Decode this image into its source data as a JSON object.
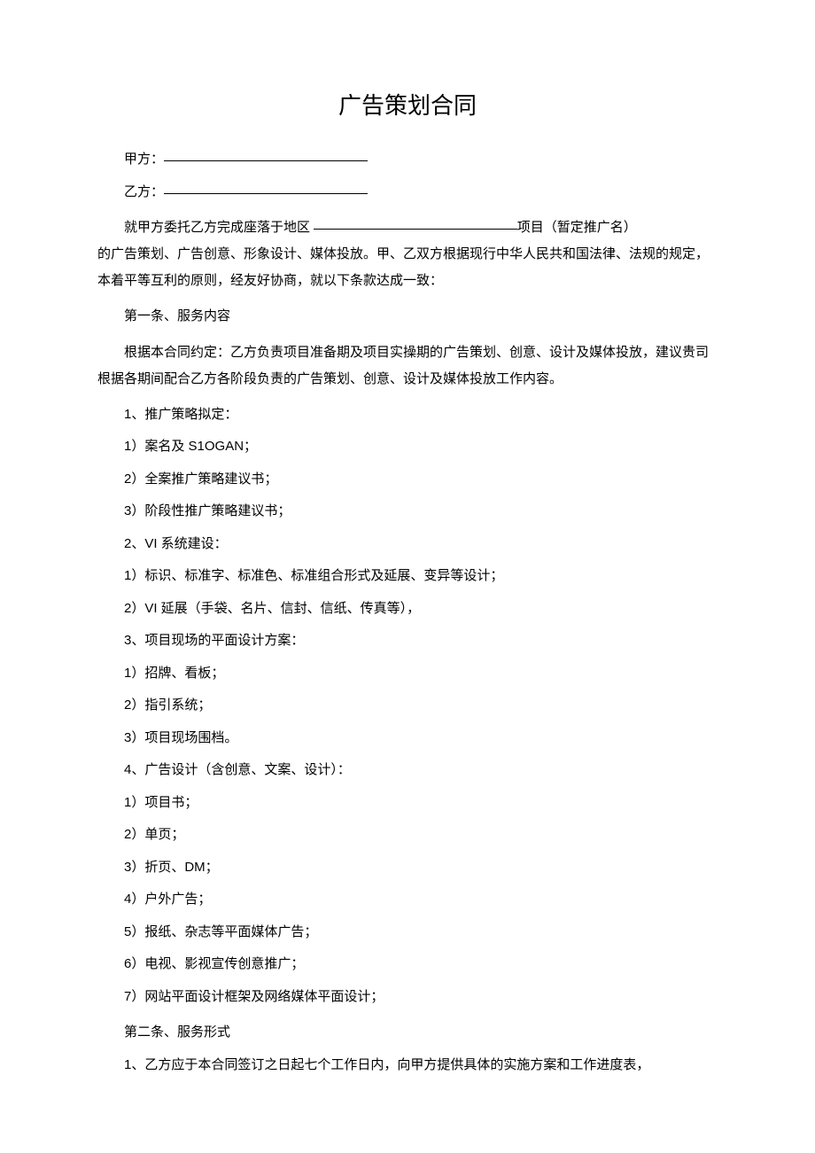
{
  "title": "广告策划合同",
  "party_a_label": "甲方：",
  "party_b_label": "乙方：",
  "intro_prefix": "就甲方委托乙方完成座落于地区",
  "intro_suffix": "项目（暂定推广名）",
  "intro_body": "的广告策划、广告创意、形象设计、媒体投放。甲、乙双方根据现行中华人民共和国法律、法规的规定，本着平等互利的原则，经友好协商，就以下条款达成一致：",
  "article1": "第一条、服务内容",
  "article1_body": "根据本合同约定：乙方负责项目准备期及项目实操期的广告策划、创意、设计及媒体投放，建议贵司根据各期间配合乙方各阶段负责的广告策划、创意、设计及媒体投放工作内容。",
  "s1_head": "1、推广策略拟定：",
  "s1_1": "1）案名及 S1OGAN；",
  "s1_2": "2）全案推广策略建议书；",
  "s1_3": "3）阶段性推广策略建议书；",
  "s2_head": "2、VI 系统建设：",
  "s2_1": "1）标识、标准字、标准色、标准组合形式及延展、变异等设计；",
  "s2_2": "2）VI 延展（手袋、名片、信封、信纸、传真等），",
  "s3_head": "3、项目现场的平面设计方案：",
  "s3_1": "1）招牌、看板；",
  "s3_2": "2）指引系统；",
  "s3_3": "3）项目现场围档。",
  "s4_head": "4、广告设计（含创意、文案、设计）：",
  "s4_1": "1）项目书；",
  "s4_2": "2）单页；",
  "s4_3": "3）折页、DM；",
  "s4_4": "4）户外广告；",
  "s4_5": "5）报纸、杂志等平面媒体广告；",
  "s4_6": "6）电视、影视宣传创意推广；",
  "s4_7": "7）网站平面设计框架及网络媒体平面设计；",
  "article2": "第二条、服务形式",
  "article2_1": "1、乙方应于本合同签订之日起七个工作日内，向甲方提供具体的实施方案和工作进度表，"
}
